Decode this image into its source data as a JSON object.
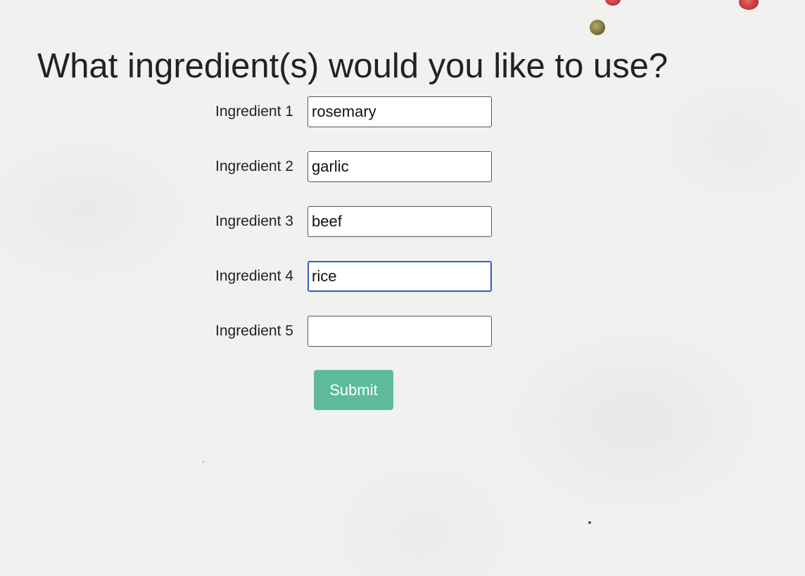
{
  "page": {
    "title": "What ingredient(s) would you like to use?"
  },
  "form": {
    "ingredients": [
      {
        "label": "Ingredient 1",
        "value": "rosemary",
        "focused": false
      },
      {
        "label": "Ingredient 2",
        "value": "garlic",
        "focused": false
      },
      {
        "label": "Ingredient 3",
        "value": "beef",
        "focused": false
      },
      {
        "label": "Ingredient 4",
        "value": "rice",
        "focused": true
      },
      {
        "label": "Ingredient 5",
        "value": "",
        "focused": false
      }
    ],
    "submit_label": "Submit"
  },
  "colors": {
    "background": "#f1f1f0",
    "submit_button": "#5dbb9a",
    "focus_ring": "#2f5fc4",
    "text": "#222222"
  }
}
